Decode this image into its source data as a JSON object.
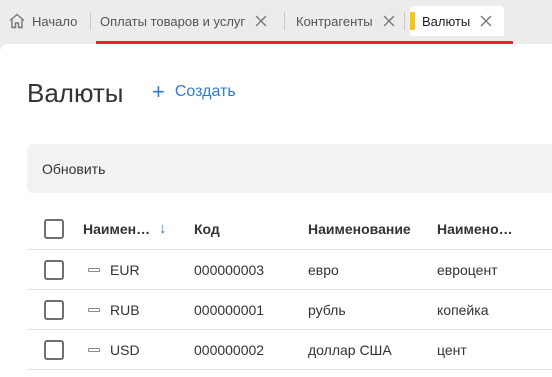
{
  "tabs": [
    {
      "label": "Начало",
      "icon": "home-icon"
    },
    {
      "label": "Оплаты товаров и услуг",
      "closable": true
    },
    {
      "label": "Контрагенты",
      "closable": true
    },
    {
      "label": "Валюты",
      "closable": true,
      "active": true
    }
  ],
  "page": {
    "title": "Валюты",
    "create_label": "Создать",
    "refresh_label": "Обновить"
  },
  "table": {
    "headers": {
      "name": "Наименование",
      "code": "Код",
      "full_name": "Наименование",
      "short_name": "Наименование"
    },
    "rows": [
      {
        "name": "EUR",
        "code": "000000003",
        "full_name": "евро",
        "short_name": "евроцент"
      },
      {
        "name": "RUB",
        "code": "000000001",
        "full_name": "рубль",
        "short_name": "копейка"
      },
      {
        "name": "USD",
        "code": "000000002",
        "full_name": "доллар США",
        "short_name": "цент"
      }
    ]
  },
  "colors": {
    "accent": "#2c7dd1",
    "tab_underline": "#e5232a",
    "active_tab_marker": "#f5c518"
  }
}
